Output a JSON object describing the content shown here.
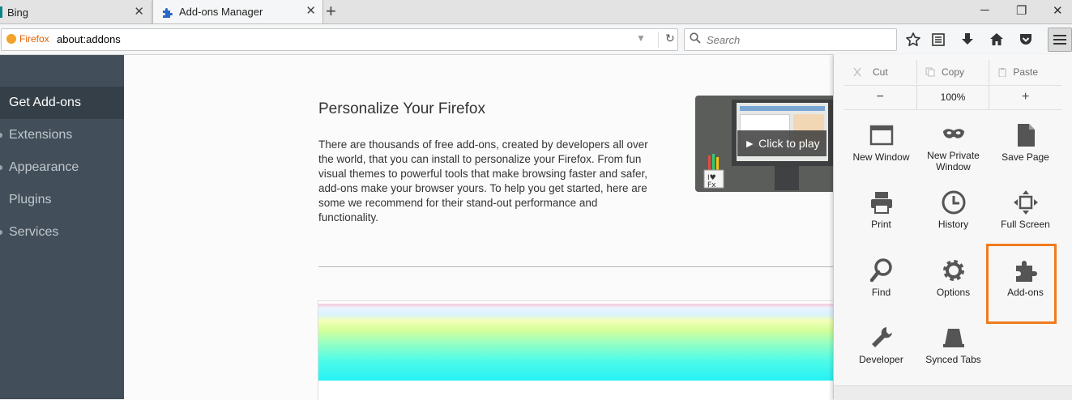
{
  "tabs": [
    {
      "title": "Bing",
      "close": "✕"
    },
    {
      "title": "Add-ons Manager",
      "close": "✕"
    }
  ],
  "new_tab": "+",
  "window_controls": {
    "minimize": "─",
    "maximize": "❐",
    "close": "✕"
  },
  "navbar": {
    "identity_label": "Firefox",
    "url": "about:addons",
    "dropdown": "▼",
    "reload": "↻",
    "search_placeholder": "Search"
  },
  "sidebar": {
    "items": [
      {
        "label": "Get Add-ons",
        "selected": true
      },
      {
        "label": "Extensions"
      },
      {
        "label": "Appearance"
      },
      {
        "label": "Plugins"
      },
      {
        "label": "Services"
      }
    ]
  },
  "main": {
    "heading": "Personalize Your Firefox",
    "intro": "There are thousands of free add-ons, created by developers all over the world, that you can install to personalize your Firefox. From fun visual themes to powerful tools that make browsing faster and safer, add-ons make your browser yours. To help you get started, here are some we recommend for their stand-out performance and functionality.",
    "video_label": "► Click to play"
  },
  "panel": {
    "edit": {
      "cut": "Cut",
      "copy": "Copy",
      "paste": "Paste"
    },
    "zoom": {
      "out": "−",
      "level": "100%",
      "in": "+"
    },
    "items": [
      {
        "label": "New Window",
        "icon": "new-window-icon"
      },
      {
        "label": "New Private Window",
        "icon": "private-mask-icon"
      },
      {
        "label": "Save Page",
        "icon": "save-page-icon"
      },
      {
        "label": "Print",
        "icon": "print-icon"
      },
      {
        "label": "History",
        "icon": "history-clock-icon"
      },
      {
        "label": "Full Screen",
        "icon": "fullscreen-icon"
      },
      {
        "label": "Find",
        "icon": "magnifier-icon"
      },
      {
        "label": "Options",
        "icon": "gear-icon"
      },
      {
        "label": "Add-ons",
        "icon": "puzzle-piece-icon"
      },
      {
        "label": "Developer",
        "icon": "wrench-icon"
      },
      {
        "label": "Synced Tabs",
        "icon": "synced-tabs-icon"
      }
    ],
    "highlight_color": "#f07b1f"
  }
}
